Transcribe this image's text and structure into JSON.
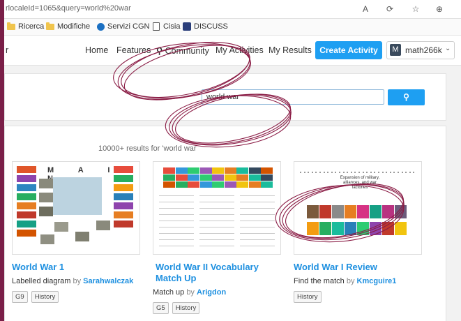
{
  "browser": {
    "url_fragment": "rlocaleId=1065&query=world%20war",
    "bookmarks": [
      {
        "icon": "folder-icon",
        "label": "Ricerca"
      },
      {
        "icon": "folder-icon",
        "label": "Modifiche"
      },
      {
        "icon": "cgn-icon",
        "label": "Servizi CGN"
      },
      {
        "icon": "document-icon",
        "label": "Cisia"
      },
      {
        "icon": "discuss-icon",
        "label": "DISCUSS"
      }
    ]
  },
  "nav": {
    "left_fragment": "r",
    "home": "Home",
    "features": "Features",
    "community": "Community",
    "my_activities": "My Activities",
    "my_results": "My Results",
    "create_activity": "Create Activity",
    "user_initial": "M",
    "username": "math266k"
  },
  "search": {
    "query": "world war",
    "button_icon": "search-icon"
  },
  "results": {
    "count_text": "10000+ results for 'world war",
    "by_word": "by",
    "cards": [
      {
        "title": "World War 1",
        "type": "Labelled diagram",
        "author": "Sarahwalczak",
        "tags": [
          "G9",
          "History"
        ],
        "thumb_heading": "M A I N"
      },
      {
        "title": "World War II Vocabulary Match Up",
        "type": "Match up",
        "author": "Arigdon",
        "tags": [
          "G5",
          "History"
        ],
        "thumb_heading": ""
      },
      {
        "title": "World War I Review",
        "type": "Find the match",
        "author": "Kmcguire1",
        "tags": [
          "History"
        ],
        "thumb_heading": "Expansion of military, alliances, and war factories"
      }
    ]
  },
  "colors": {
    "accent": "#1e9ff2",
    "link": "#1e90e0",
    "frame": "#7a1f48",
    "scribble": "#8a1c45"
  }
}
